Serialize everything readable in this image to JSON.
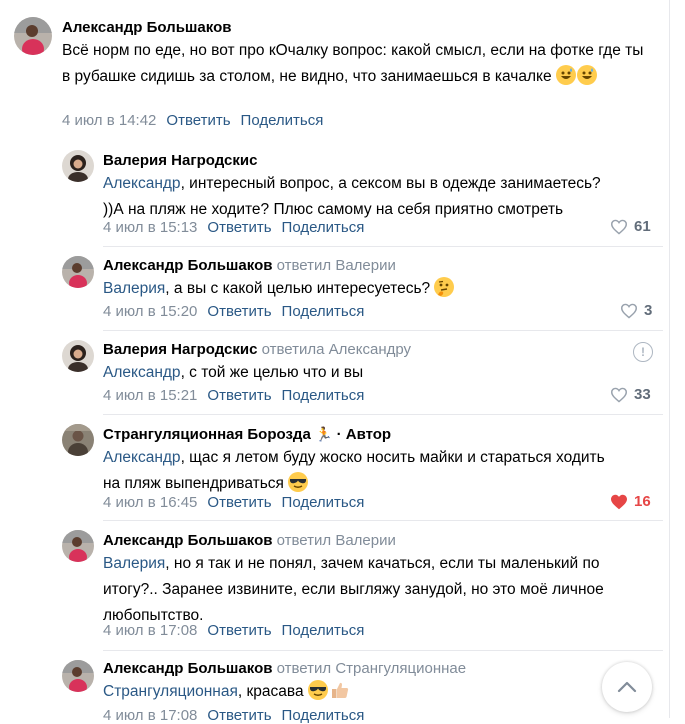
{
  "comments": [
    {
      "author": "Александр Большаков",
      "reply_note": "",
      "text": "Всё норм по еде, но вот про кОчалку вопрос: какой смысл, если на фотке где ты в рубашке сидишь за столом, не видно, что занимаешься в качалке",
      "emojis": [
        "grinning-sweat",
        "grinning-sweat"
      ],
      "time": "4 июл в 14:42",
      "reply_label": "Ответить",
      "share_label": "Поделиться",
      "likes": ""
    },
    {
      "author": "Валерия Нагродскис",
      "mention": "Александр",
      "text_line1": ", интересный вопрос, а сексом вы в одежде занимаетесь?",
      "text_line2": "))А на пляж не ходите? Плюс самому на себя приятно смотреть",
      "time": "4 июл в 15:13",
      "reply_label": "Ответить",
      "share_label": "Поделиться",
      "likes": "61"
    },
    {
      "author": "Александр Большаков",
      "reply_note": "ответил Валерии",
      "mention": "Валерия",
      "text": ", а вы с какой целью интересуетесь?",
      "emojis": [
        "thinking-face"
      ],
      "time": "4 июл в 15:20",
      "reply_label": "Ответить",
      "share_label": "Поделиться",
      "likes": "3"
    },
    {
      "author": "Валерия Нагродскис",
      "reply_note": "ответила Александру",
      "mention": "Александр",
      "text": ", с той же целью что и вы",
      "time": "4 июл в 15:21",
      "reply_label": "Ответить",
      "share_label": "Поделиться",
      "likes": "33"
    },
    {
      "author": "Странгуляционная Борозда",
      "badge": "🏃",
      "author_suffix": "· Автор",
      "mention": "Александр",
      "text_line1": ", щас я летом буду жоско носить майки и стараться ходить",
      "text_line2": "на пляж выпендриваться",
      "emojis": [
        "sunglasses"
      ],
      "time": "4 июл в 16:45",
      "reply_label": "Ответить",
      "share_label": "Поделиться",
      "likes": "16"
    },
    {
      "author": "Александр Большаков",
      "reply_note": "ответил Валерии",
      "mention": "Валерия",
      "text_line1": ", но я так и не понял, зачем качаться, если ты маленький по",
      "text_line2": "итогу?.. Заранее извините, если выгляжу занудой, но это моё личное",
      "text_line3": "любопытство.",
      "time": "4 июл в 17:08",
      "reply_label": "Ответить",
      "share_label": "Поделиться",
      "likes": ""
    },
    {
      "author": "Александр Большаков",
      "reply_note": "ответил Странгуляционнае",
      "mention": "Странгуляционная",
      "text": ", красава",
      "emojis": [
        "sunglasses",
        "thumbs-up"
      ],
      "time": "4 июл в 17:08",
      "reply_label": "Ответить",
      "share_label": "Поделиться",
      "likes": ""
    }
  ],
  "icons": {
    "like": "heart-icon",
    "liked": "heart-filled-icon",
    "report": "exclamation-circle-icon",
    "scroll_up": "chevron-up-icon"
  },
  "colors": {
    "link": "#2a5885",
    "meta": "#818c99",
    "liked": "#e64646",
    "separator": "#e7e8ec"
  }
}
